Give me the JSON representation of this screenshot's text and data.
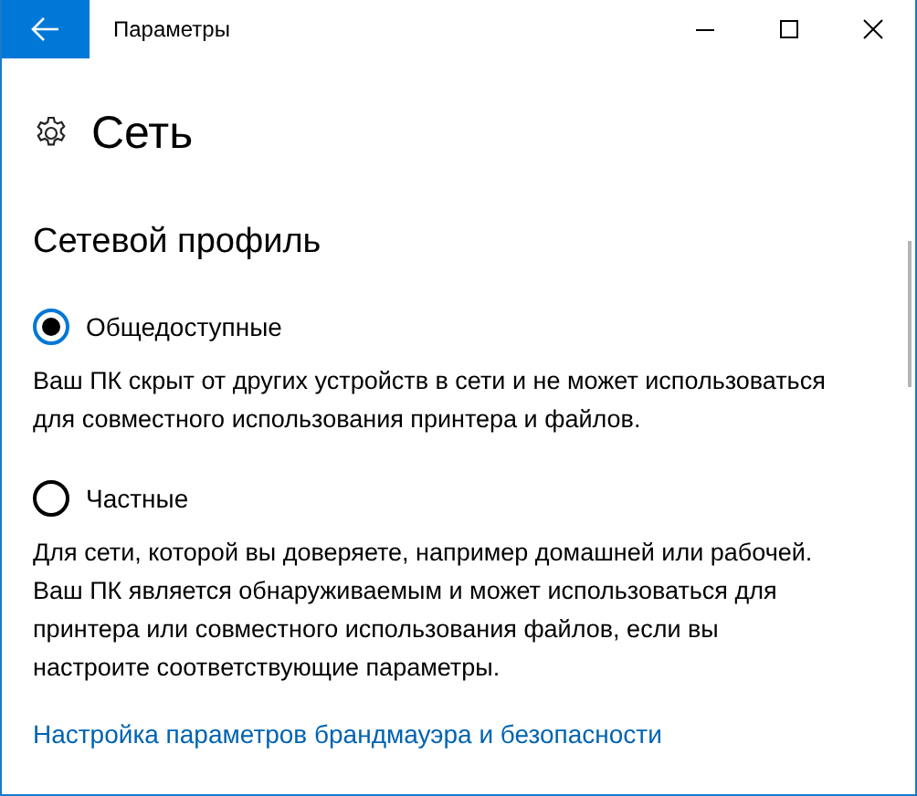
{
  "window": {
    "title": "Параметры"
  },
  "page": {
    "title": "Сеть"
  },
  "section": {
    "title": "Сетевой профиль"
  },
  "options": [
    {
      "label": "Общедоступные",
      "selected": true,
      "description": "Ваш ПК скрыт от других устройств в сети и не может использоваться для совместного использования принтера и файлов."
    },
    {
      "label": "Частные",
      "selected": false,
      "description": "Для сети, которой вы доверяете, например домашней или рабочей. Ваш ПК является обнаруживаемым и может использоваться для принтера или совместного использования файлов, если вы настроите соответствующие параметры."
    }
  ],
  "link": "Настройка параметров брандмауэра и безопасности"
}
